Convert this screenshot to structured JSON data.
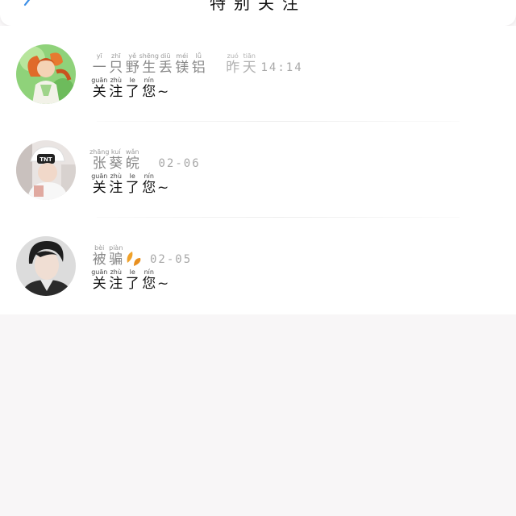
{
  "header": {
    "title": "特别关注",
    "back_icon": "chevron-left-icon",
    "accent": "#3a8ee6"
  },
  "follows": [
    {
      "name": [
        {
          "py": "yī",
          "ch": "一"
        },
        {
          "py": "zhī",
          "ch": "只"
        },
        {
          "py": "yě",
          "ch": "野"
        },
        {
          "py": "shēng",
          "ch": "生"
        },
        {
          "py": "diū",
          "ch": "丢"
        },
        {
          "py": "méi",
          "ch": "镁"
        },
        {
          "py": "lǚ",
          "ch": "铝"
        }
      ],
      "time_chars": [
        {
          "py": "zuó",
          "ch": "昨"
        },
        {
          "py": "tiān",
          "ch": "天"
        }
      ],
      "time": "14:14",
      "message": [
        {
          "py": "guān",
          "ch": "关"
        },
        {
          "py": "zhù",
          "ch": "注"
        },
        {
          "py": "le",
          "ch": "了"
        },
        {
          "py": "nín",
          "ch": "您"
        }
      ],
      "message_tail": "~",
      "avatar": "anime-fox-girl-avatar"
    },
    {
      "name": [
        {
          "py": "zhāng",
          "ch": "张"
        },
        {
          "py": "kuí",
          "ch": "葵"
        },
        {
          "py": "wǎn",
          "ch": "皖"
        }
      ],
      "time": "02-06",
      "message": [
        {
          "py": "guān",
          "ch": "关"
        },
        {
          "py": "zhù",
          "ch": "注"
        },
        {
          "py": "le",
          "ch": "了"
        },
        {
          "py": "nín",
          "ch": "您"
        }
      ],
      "message_tail": "~",
      "avatar": "tnt-hat-avatar"
    },
    {
      "name": [
        {
          "py": "bèi",
          "ch": "被"
        },
        {
          "py": "piàn",
          "ch": "骗"
        }
      ],
      "name_icon": "orange-leaf-icon",
      "time": "02-05",
      "message": [
        {
          "py": "guān",
          "ch": "关"
        },
        {
          "py": "zhù",
          "ch": "注"
        },
        {
          "py": "le",
          "ch": "了"
        },
        {
          "py": "nín",
          "ch": "您"
        }
      ],
      "message_tail": "~",
      "avatar": "young-man-avatar"
    }
  ]
}
